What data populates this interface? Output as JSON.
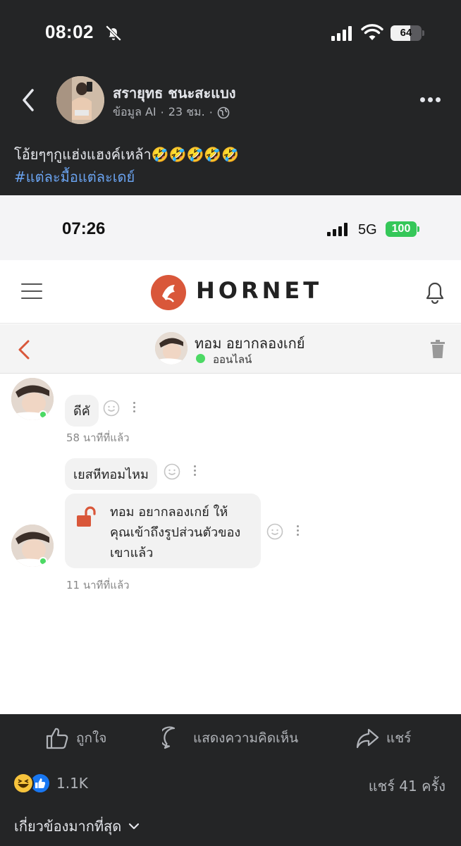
{
  "status_bar": {
    "time": "08:02",
    "battery": "64",
    "battery_level": 0.64
  },
  "post": {
    "author": "สรายุทธ ชนะสะแบง",
    "meta_source": "ข้อมูล AI",
    "meta_time": "23 ชม.",
    "text": "โอ้ยๆๆกูแฮ่งแฮงค์เหล้า🤣🤣🤣🤣🤣",
    "hashtag": "#แต่ละมื้อแต่ละเดย์"
  },
  "screenshot": {
    "status_time": "07:26",
    "network": "5G",
    "battery": "100",
    "app_name": "HORNET",
    "chat": {
      "contact_name": "ทอม อยากลองเกย์",
      "online_label": "ออนไลน์",
      "messages": [
        {
          "text": "ดีคั"
        },
        {
          "time_ago": "58 นาทีที่แล้ว"
        },
        {
          "text": "เยสหีทอมไหม"
        },
        {
          "text_lines": [
            "ทอม อยากลองเกย์ ให้",
            "คุณเข้าถึงรูปส่วนตัวของ",
            "เขาแล้ว"
          ]
        },
        {
          "time_ago": "11 นาทีที่แล้ว"
        }
      ]
    }
  },
  "actions": {
    "like": "ถูกใจ",
    "comment": "แสดงความคิดเห็น",
    "share": "แชร์"
  },
  "stats": {
    "reactions_count": "1.1K",
    "shares": "แชร์ 41 ครั้ง"
  },
  "sort_label": "เกี่ยวข้องมากที่สุด",
  "icons": [
    "bell-off-icon",
    "signal-icon",
    "wifi-icon",
    "battery-icon",
    "back-chevron-icon",
    "globe-icon",
    "more-icon",
    "hamburger-icon",
    "hornet-logo",
    "bell-icon",
    "trash-icon",
    "smile-icon",
    "kebab-icon",
    "unlock-icon",
    "like-icon",
    "comment-icon",
    "share-icon",
    "haha-reaction-icon",
    "like-reaction-icon",
    "chevron-down-icon"
  ],
  "colors": {
    "facebook_bg": "#242526",
    "hashtag": "#6aa3f0",
    "hornet_accent": "#d9573a",
    "online": "#4cd964",
    "like_blue": "#1877f2"
  }
}
